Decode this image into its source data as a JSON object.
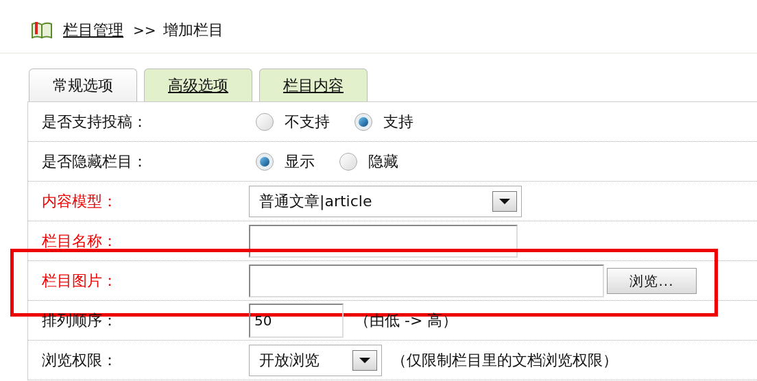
{
  "breadcrumb": {
    "link": "栏目管理",
    "separator": ">>",
    "current": "增加栏目"
  },
  "tabs": [
    {
      "label": "常规选项",
      "selected": true
    },
    {
      "label": "高级选项",
      "selected": false
    },
    {
      "label": "栏目内容",
      "selected": false
    }
  ],
  "rows": [
    {
      "kind": "radio",
      "label": "是否支持投稿：",
      "required": false,
      "options": [
        {
          "label": "不支持",
          "selected": false
        },
        {
          "label": "支持",
          "selected": true
        }
      ]
    },
    {
      "kind": "radio",
      "label": "是否隐藏栏目：",
      "required": false,
      "options": [
        {
          "label": "显示",
          "selected": true
        },
        {
          "label": "隐藏",
          "selected": false
        }
      ]
    },
    {
      "kind": "select",
      "label": "内容模型：",
      "required": true,
      "value": "普通文章|article"
    },
    {
      "kind": "text",
      "label": "栏目名称：",
      "required": true
    },
    {
      "kind": "file",
      "label": "栏目图片：",
      "required": true,
      "button": "浏览...",
      "highlighted": true
    },
    {
      "kind": "text",
      "label": "排列顺序：",
      "required": false,
      "value": "50",
      "hint": "（由低 -> 高）"
    },
    {
      "kind": "select",
      "label": "浏览权限：",
      "required": false,
      "value": "开放浏览",
      "hint": "（仅限制栏目里的文档浏览权限）"
    }
  ]
}
